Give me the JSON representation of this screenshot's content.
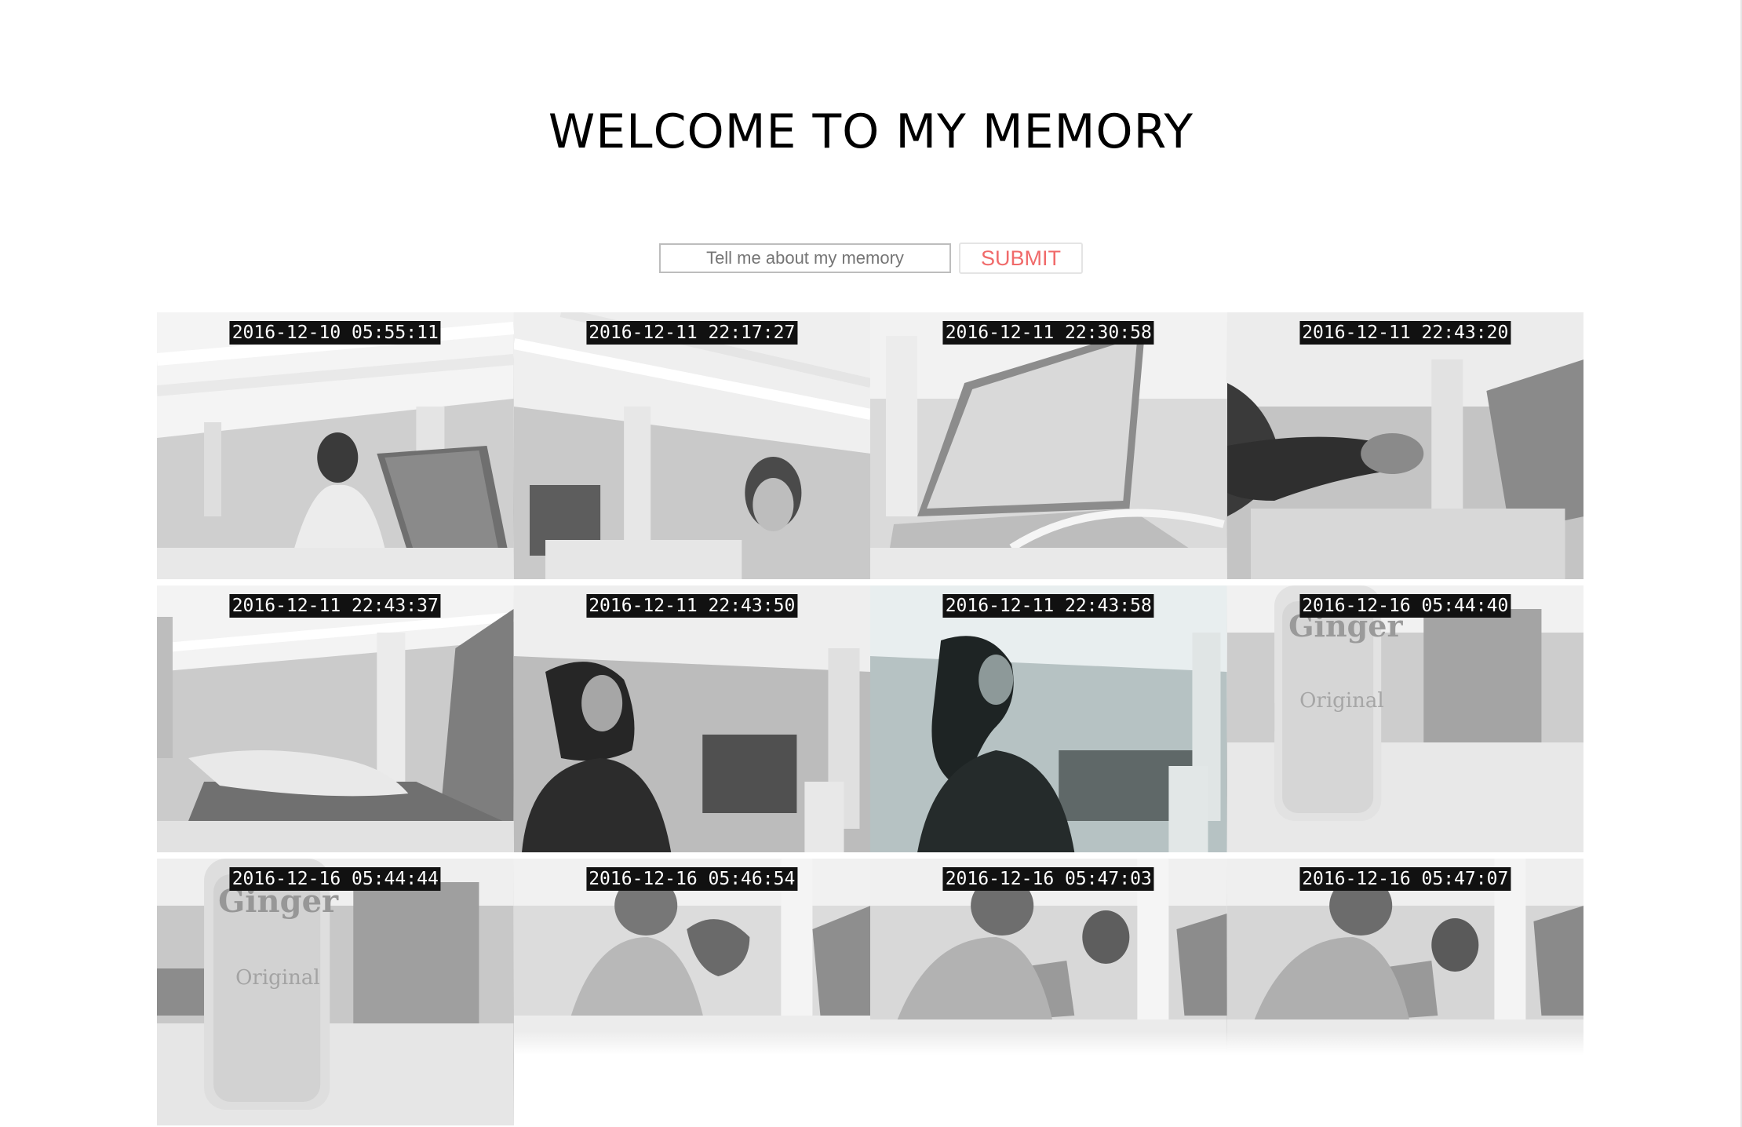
{
  "page": {
    "title": "WELCOME TO MY MEMORY"
  },
  "form": {
    "input_placeholder": "Tell me about my memory",
    "input_value": "",
    "submit_label": "SUBMIT"
  },
  "gallery": {
    "photos": [
      {
        "timestamp": "2016-12-10 05:55:11",
        "scene": "office-person-laptop"
      },
      {
        "timestamp": "2016-12-11 22:17:27",
        "scene": "office-person-face"
      },
      {
        "timestamp": "2016-12-11 22:30:58",
        "scene": "laptop-closeup"
      },
      {
        "timestamp": "2016-12-11 22:43:20",
        "scene": "hand-blur"
      },
      {
        "timestamp": "2016-12-11 22:43:37",
        "scene": "hands-typing"
      },
      {
        "timestamp": "2016-12-11 22:43:50",
        "scene": "person-standing"
      },
      {
        "timestamp": "2016-12-11 22:43:58",
        "scene": "person-walking"
      },
      {
        "timestamp": "2016-12-16 05:44:40",
        "scene": "ginger-bottle"
      },
      {
        "timestamp": "2016-12-16 05:44:44",
        "scene": "ginger-bottle"
      },
      {
        "timestamp": "2016-12-16 05:46:54",
        "scene": "two-people-laptops"
      },
      {
        "timestamp": "2016-12-16 05:47:03",
        "scene": "two-people-laptops"
      },
      {
        "timestamp": "2016-12-16 05:47:07",
        "scene": "two-people-laptops"
      }
    ]
  }
}
